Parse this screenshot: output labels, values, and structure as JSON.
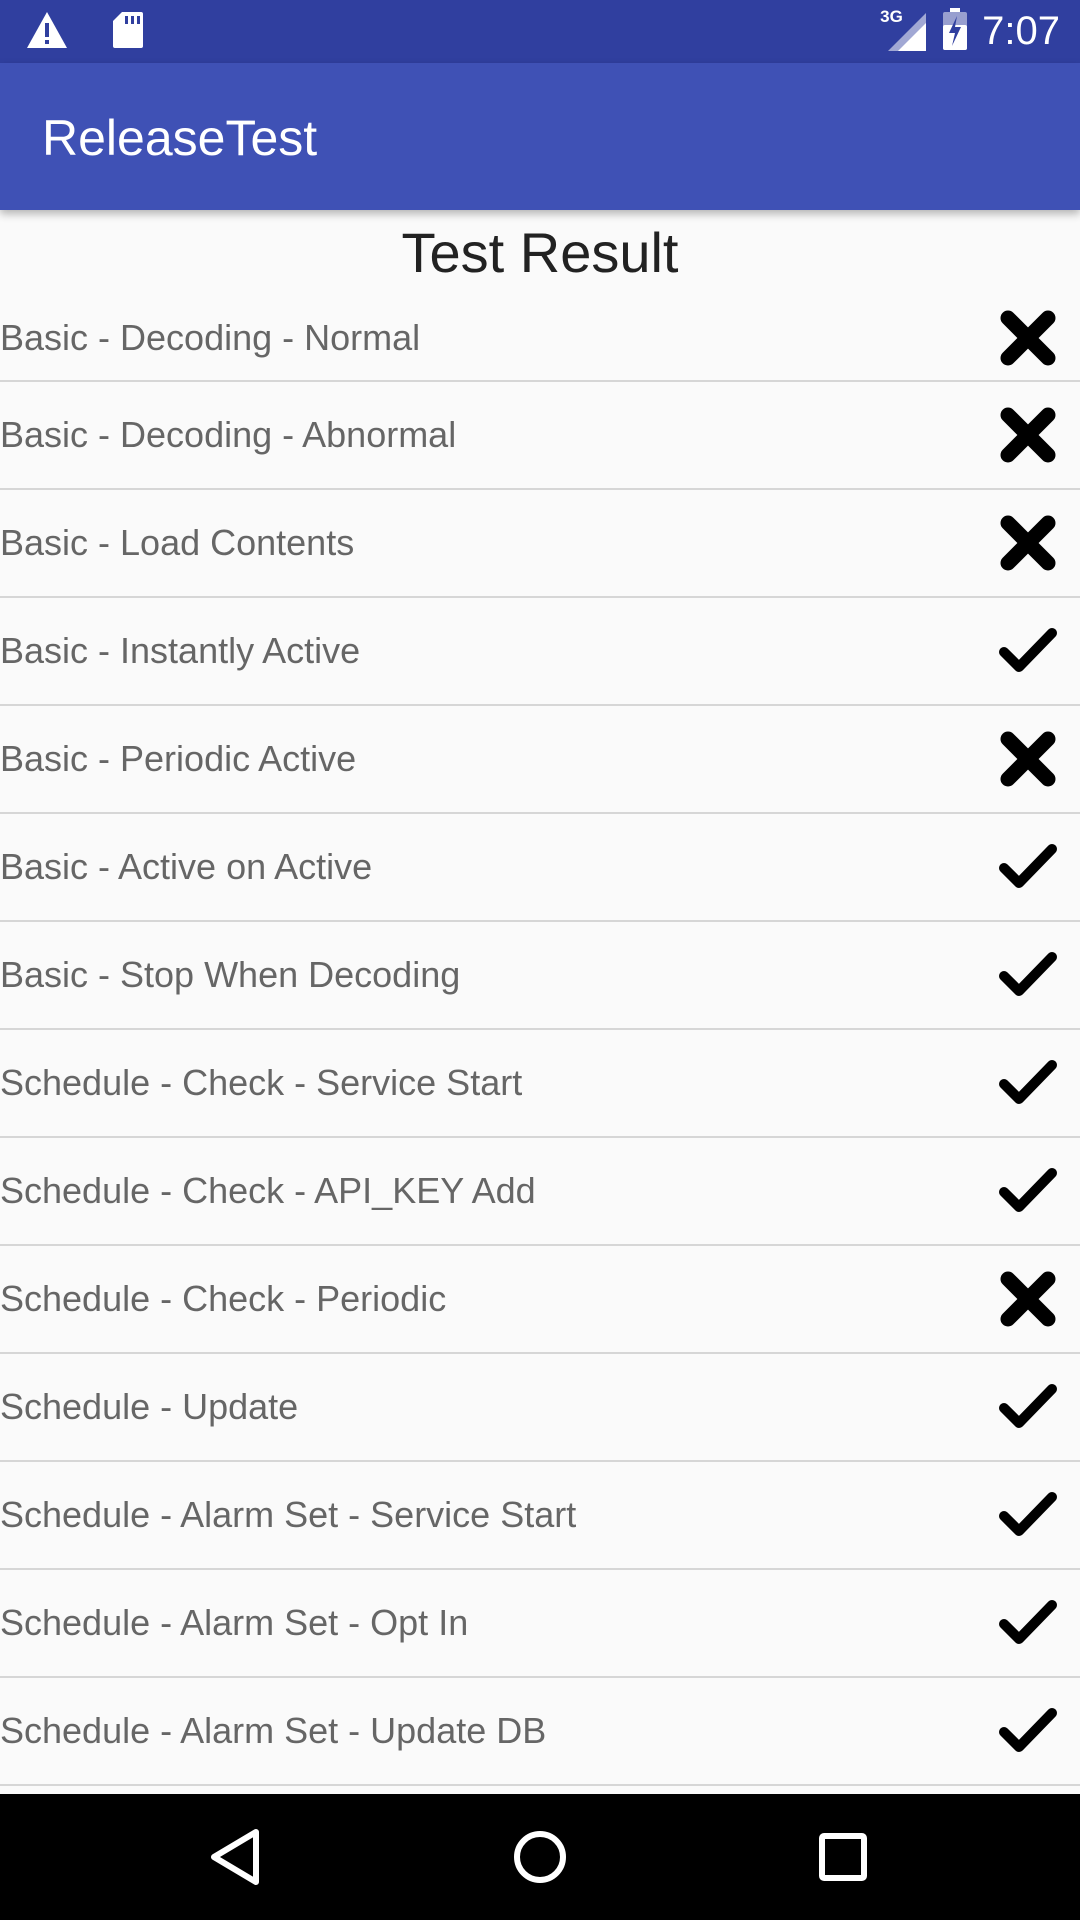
{
  "status_bar": {
    "time": "7:07",
    "network": "3G",
    "icons": [
      "warning-icon",
      "sd-card-icon",
      "signal-icon",
      "battery-charging-icon"
    ]
  },
  "app_bar": {
    "title": "ReleaseTest"
  },
  "heading": "Test Result",
  "results": [
    {
      "label": "Basic - Decoding - Normal",
      "status": "fail"
    },
    {
      "label": "Basic - Decoding - Abnormal",
      "status": "fail"
    },
    {
      "label": "Basic - Load Contents",
      "status": "fail"
    },
    {
      "label": "Basic - Instantly Active",
      "status": "pass"
    },
    {
      "label": "Basic - Periodic Active",
      "status": "fail"
    },
    {
      "label": "Basic - Active on Active",
      "status": "pass"
    },
    {
      "label": "Basic - Stop When Decoding",
      "status": "pass"
    },
    {
      "label": "Schedule - Check - Service Start",
      "status": "pass"
    },
    {
      "label": "Schedule - Check - API_KEY Add",
      "status": "pass"
    },
    {
      "label": "Schedule - Check - Periodic",
      "status": "fail"
    },
    {
      "label": "Schedule - Update",
      "status": "pass"
    },
    {
      "label": "Schedule - Alarm Set - Service Start",
      "status": "pass"
    },
    {
      "label": "Schedule - Alarm Set - Opt In",
      "status": "pass"
    },
    {
      "label": "Schedule - Alarm Set - Update DB",
      "status": "pass"
    }
  ],
  "nav": [
    "back-icon",
    "home-icon",
    "recents-icon"
  ]
}
